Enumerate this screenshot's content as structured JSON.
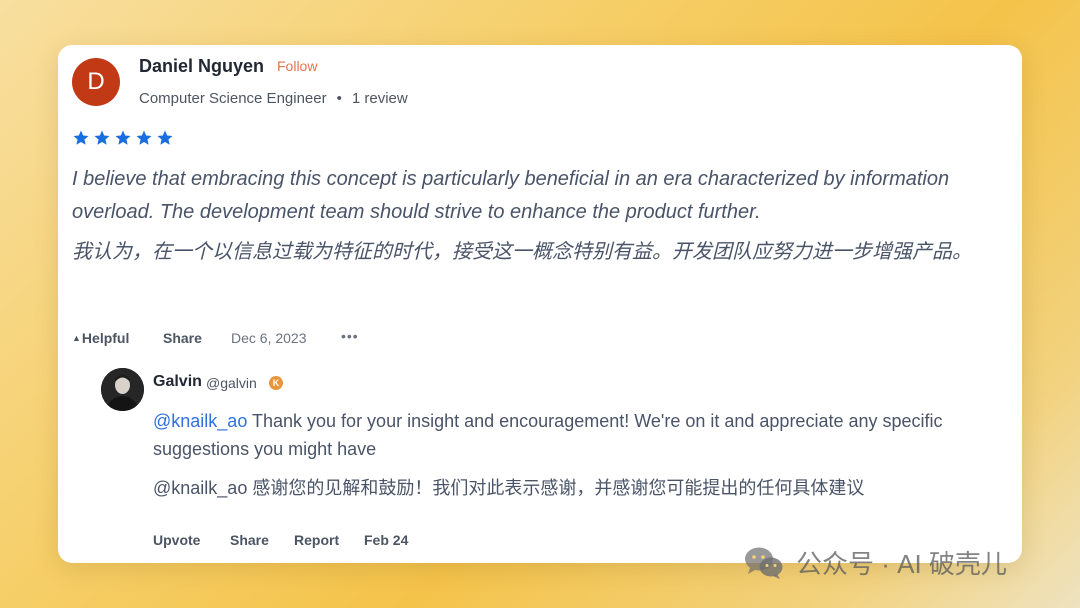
{
  "review": {
    "avatar_letter": "D",
    "author": "Daniel Nguyen",
    "follow_label": "Follow",
    "job_title": "Computer Science Engineer",
    "separator": "•",
    "review_count": "1 review",
    "rating": 5,
    "rating_max": 5,
    "star_color": "#1a6fe0",
    "text_en": "I believe that embracing this concept is particularly beneficial in an era characterized by information overload. The development team should strive to enhance the product further.",
    "text_zh": "我认为，在一个以信息过载为特征的时代，接受这一概念特别有益。开发团队应努力进一步增强产品。",
    "actions": {
      "helpful_icon": "▲",
      "helpful": "Helpful",
      "share": "Share",
      "date": "Dec 6, 2023",
      "more": "•••"
    }
  },
  "reply": {
    "name": "Galvin",
    "handle": "@galvin",
    "badge": "K",
    "mention": "@knailk_ao",
    "text_en": " Thank you for your insight and encouragement! We're on it and appreciate any specific suggestions you might have",
    "text_zh": "@knailk_ao 感谢您的见解和鼓励！我们对此表示感谢，并感谢您可能提出的任何具体建议",
    "actions": {
      "upvote": "Upvote",
      "share": "Share",
      "report": "Report",
      "date": "Feb 24"
    }
  },
  "watermark": {
    "icon": "wechat-icon",
    "text": "公众号 · AI 破壳儿"
  }
}
